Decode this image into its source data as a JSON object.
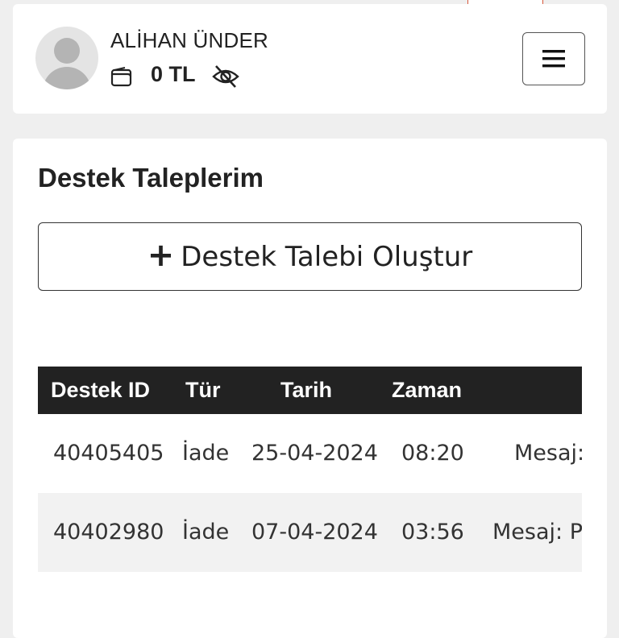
{
  "header": {
    "user_name": "ALİHAN ÜNDER",
    "balance": "0 TL",
    "icons": {
      "wallet": "wallet-icon",
      "visibility": "eye-slash-icon",
      "menu": "hamburger-icon",
      "avatar": "user-avatar-placeholder"
    }
  },
  "main": {
    "title": "Destek Taleplerim",
    "create_button_label": "Destek Talebi Oluştur",
    "table": {
      "columns": [
        "Destek ID",
        "Tür",
        "Tarih",
        "Zaman",
        ""
      ],
      "rows": [
        {
          "id": "40405405",
          "type": "İade",
          "date": "25-04-2024",
          "time": "08:20",
          "message": "Mesaj:"
        },
        {
          "id": "40402980",
          "type": "İade",
          "date": "07-04-2024",
          "time": "03:56",
          "message": "Mesaj: Pa"
        }
      ]
    }
  },
  "colors": {
    "background": "#efefef",
    "card": "#ffffff",
    "table_header": "#222222",
    "alt_row": "#f2f2f2",
    "accent_tab_border": "#d8573a"
  }
}
